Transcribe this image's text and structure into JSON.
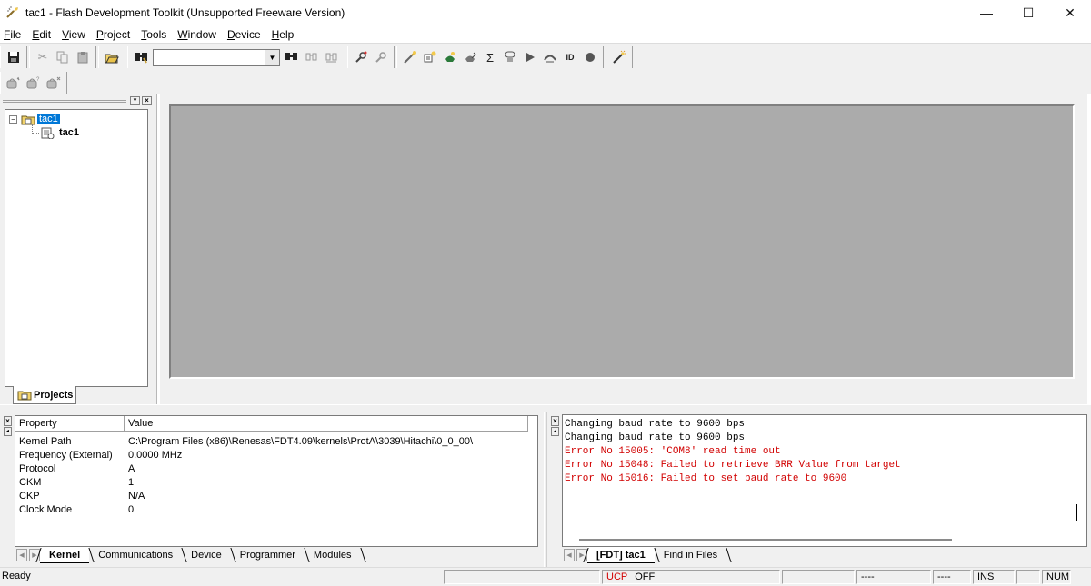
{
  "window": {
    "title": "tac1 - Flash Development Toolkit  (Unsupported Freeware Version)",
    "minimize": "—",
    "maximize": "☐",
    "close": "✕"
  },
  "menu": {
    "items": [
      {
        "mnemonic": "F",
        "rest": "ile"
      },
      {
        "mnemonic": "E",
        "rest": "dit"
      },
      {
        "mnemonic": "V",
        "rest": "iew"
      },
      {
        "mnemonic": "P",
        "rest": "roject"
      },
      {
        "mnemonic": "T",
        "rest": "ools"
      },
      {
        "mnemonic": "W",
        "rest": "indow"
      },
      {
        "mnemonic": "D",
        "rest": "evice"
      },
      {
        "mnemonic": "H",
        "rest": "elp"
      }
    ]
  },
  "toolbar": {
    "find_value": "",
    "icons": {
      "save": "save-icon",
      "cut": "cut-icon",
      "copy": "copy-icon",
      "paste": "paste-icon",
      "open_workspace": "open-workspace-icon",
      "find": "find-icon",
      "find_next": "find-next-icon",
      "find_prev": "find-previous-icon",
      "find_all": "find-all-icon"
    }
  },
  "workspace": {
    "tree": {
      "root_label": "tac1",
      "child_label": "tac1"
    },
    "tab_label": "Projects"
  },
  "properties": {
    "columns": [
      "Property",
      "Value"
    ],
    "rows": [
      {
        "name": "Kernel Path",
        "value": "C:\\Program Files (x86)\\Renesas\\FDT4.09\\kernels\\ProtA\\3039\\Hitachi\\0_0_00\\"
      },
      {
        "name": "Frequency (External)",
        "value": "0.0000 MHz"
      },
      {
        "name": "Protocol",
        "value": "A"
      },
      {
        "name": "CKM",
        "value": "1"
      },
      {
        "name": "CKP",
        "value": "N/A"
      },
      {
        "name": "Clock Mode",
        "value": "0"
      }
    ],
    "tabs": [
      "Kernel",
      "Communications",
      "Device",
      "Programmer",
      "Modules"
    ]
  },
  "output": {
    "lines": [
      {
        "text": "Changing baud rate to 9600 bps",
        "type": "info"
      },
      {
        "text": "Changing baud rate to 9600 bps",
        "type": "info"
      },
      {
        "text": "Error No 15005: 'COM8' read time out",
        "type": "error"
      },
      {
        "text": "Error No 15048: Failed to retrieve BRR Value from target",
        "type": "error"
      },
      {
        "text": "Error No 15016: Failed to set baud rate to 9600",
        "type": "error"
      }
    ],
    "tabs": [
      "[FDT] tac1",
      "Find in Files"
    ]
  },
  "status": {
    "text": "Ready",
    "ucp_label": "UCP",
    "ucp_value": "OFF",
    "pos1": "----",
    "pos2": "----",
    "ins": "INS",
    "num": "NUM"
  },
  "colors": {
    "error": "#d10000",
    "selection": "#0078d7",
    "mdi_background": "#ababab"
  }
}
